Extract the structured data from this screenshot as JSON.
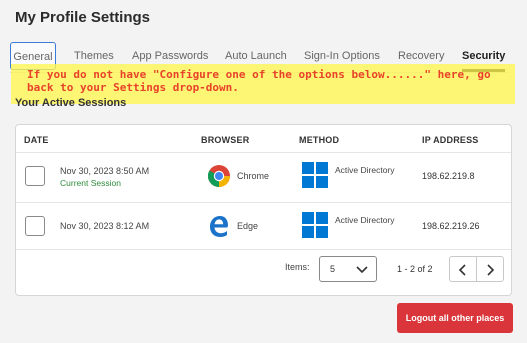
{
  "page_title": "My Profile Settings",
  "tabs": [
    {
      "label": "General"
    },
    {
      "label": "Themes"
    },
    {
      "label": "App Passwords"
    },
    {
      "label": "Auto Launch"
    },
    {
      "label": "Sign-In Options"
    },
    {
      "label": "Recovery"
    },
    {
      "label": "Security"
    }
  ],
  "active_tab": "Security",
  "annotation": "If you do not have \"Configure one of the options below......\" here, go back to your Settings drop-down.",
  "section_heading": "Your Active Sessions",
  "table": {
    "headers": [
      "DATE",
      "BROWSER",
      "METHOD",
      "IP ADDRESS"
    ],
    "rows": [
      {
        "date": "Nov 30, 2023 8:50 AM",
        "status": "Current Session",
        "browser": "Chrome",
        "method": "Active Directory",
        "ip": "198.62.219.8"
      },
      {
        "date": "Nov 30, 2023 8:12 AM",
        "status": "",
        "browser": "Edge",
        "method": "Active Directory",
        "ip": "198.62.219.26"
      }
    ]
  },
  "pagination": {
    "items_label": "Items:",
    "items_value": "5",
    "range": "1 - 2 of 2"
  },
  "logout_label": "Logout all other places",
  "colors": {
    "accent_red": "#d9353a",
    "current_session_green": "#2e8b3a",
    "annotation_red": "#e8422a",
    "highlight_yellow": "#fff550",
    "windows_blue": "#0078d4"
  }
}
